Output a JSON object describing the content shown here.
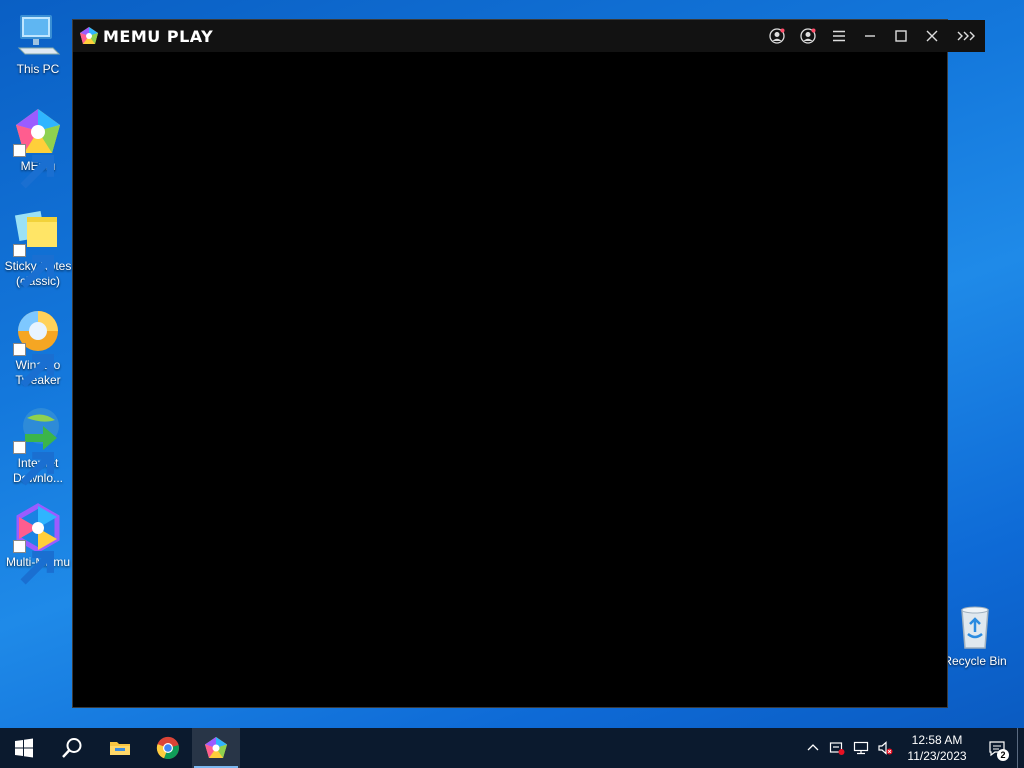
{
  "desktop": {
    "icons": [
      {
        "label": "This PC",
        "icon": "computer-icon"
      },
      {
        "label": "MEmu",
        "icon": "memu-icon"
      },
      {
        "label": "Sticky Notes (classic)",
        "icon": "sticky-notes-icon"
      },
      {
        "label": "Winaero Tweaker",
        "icon": "winaero-tweaker-icon"
      },
      {
        "label": "Internet Downlo...",
        "icon": "internet-download-manager-icon"
      },
      {
        "label": "Multi-MEmu",
        "icon": "multi-memu-icon"
      },
      {
        "label": "Recycle Bin",
        "icon": "recycle-bin-icon"
      }
    ]
  },
  "memu": {
    "title": "MEMU PLAY",
    "controls": [
      "account-icon",
      "user-settings-icon",
      "menu-icon",
      "minimize-icon",
      "maximize-icon",
      "close-icon",
      "expand-sidebar-icon"
    ]
  },
  "taskbar": {
    "pinned": [
      "windows-start-icon",
      "search-icon",
      "file-explorer-icon",
      "chrome-icon",
      "memu-icon"
    ],
    "tray": {
      "time": "12:58 AM",
      "date": "11/23/2023",
      "notifications": "2"
    }
  },
  "colors": {
    "accent": "#1478dc",
    "taskbar": "#0b1a2e",
    "memu_title": "#121212"
  }
}
